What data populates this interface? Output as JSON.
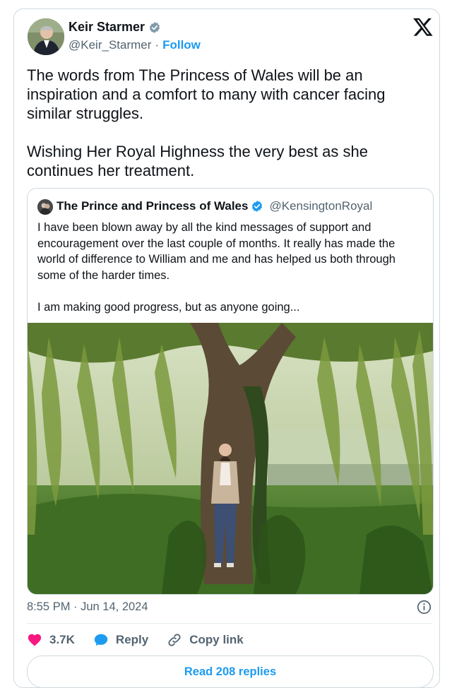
{
  "author": {
    "name": "Keir Starmer",
    "handle": "@Keir_Starmer",
    "separator": "·",
    "follow_label": "Follow",
    "verified": true
  },
  "tweet": {
    "text": "The words from The Princess of Wales will be an\ninspiration and a comfort to many with cancer facing\nsimilar struggles.\n\nWishing Her Royal Highness the very best as she\ncontinues her treatment."
  },
  "quoted_tweet": {
    "name": "The Prince and Princess of Wales",
    "handle": "@KensingtonRoyal",
    "verified": true,
    "text": "I have been blown away by all the kind messages of support and\nencouragement over the last couple of months. It really has made the\nworld of difference to William and me and has helped us both through\nsome of the harder times.\n\nI am making good progress, but as anyone going..."
  },
  "meta": {
    "timestamp": "8:55 PM · Jun 14, 2024"
  },
  "actions": {
    "likes": "3.7K",
    "reply_label": "Reply",
    "copy_label": "Copy link"
  },
  "read_replies_label": "Read 208 replies",
  "colors": {
    "accent": "#1d9bf0",
    "like": "#f91880",
    "muted": "#536471",
    "verified_badge": "#829aab"
  },
  "icons": [
    "verified-badge-icon",
    "x-logo-icon",
    "info-icon",
    "heart-icon",
    "reply-bubble-icon",
    "link-icon"
  ]
}
